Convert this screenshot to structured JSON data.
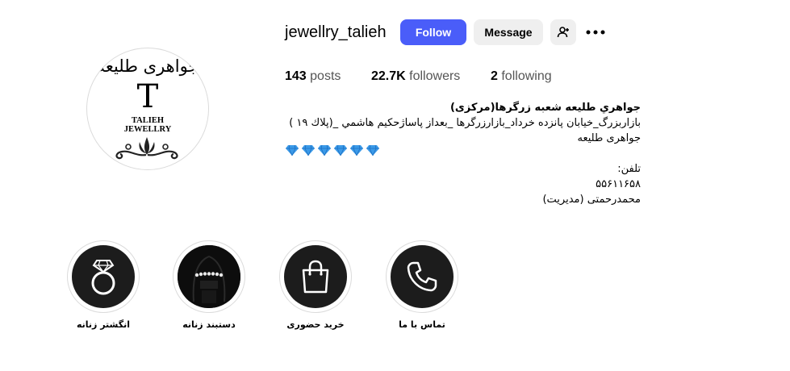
{
  "profile": {
    "username": "jewellry_talieh",
    "avatar": {
      "persian_text": "جواهری طلیعه",
      "monogram": "T",
      "brand_line1": "TALIEH",
      "brand_line2": "JEWELLRY"
    }
  },
  "actions": {
    "follow_label": "Follow",
    "message_label": "Message",
    "add_user_icon": "person-add-icon",
    "more_icon": "more-options-icon"
  },
  "stats": {
    "posts": {
      "count": "143",
      "label": "posts"
    },
    "followers": {
      "count": "22.7K",
      "label": "followers"
    },
    "following": {
      "count": "2",
      "label": "following"
    }
  },
  "bio": {
    "title": "جواهري طلیعه شعبه زرگرها(مرکزی)",
    "address": "بازاربزرگ_خیابان پانزده خرداد_بازارزرگرها _بعداز پاساژحکیم هاشمي _(پلاك ۱۹ )",
    "brand": "جواهری طلیعه",
    "gems": "💎💎💎💎💎💎",
    "phone_label": "تلفن:",
    "phone": "۵۵۶۱۱۶۵۸",
    "manager": "محمدرحمتی (مدیریت)"
  },
  "highlights": [
    {
      "label": "انگشتر زنانه",
      "icon": "ring-icon"
    },
    {
      "label": "دستبند زنانه",
      "icon": "bracelet-photo"
    },
    {
      "label": "خرید حضوری",
      "icon": "shopping-bag-icon"
    },
    {
      "label": "تماس با ما",
      "icon": "phone-icon"
    }
  ],
  "colors": {
    "follow_button": "#4a5df9",
    "secondary_button": "#efefef",
    "highlight_bg": "#1c1c1c",
    "gem": "#3b9ae8"
  }
}
